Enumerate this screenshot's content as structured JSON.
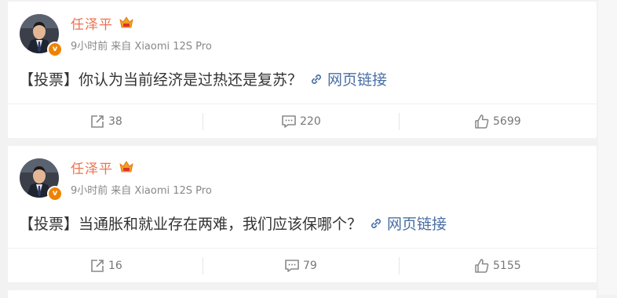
{
  "colors": {
    "author": "#eb7350",
    "link": "#4a6fa5",
    "meta": "#888888",
    "badge": "#f08200"
  },
  "posts": [
    {
      "author": "任泽平",
      "badge_letter": "v",
      "time": "9小时前",
      "source": "来自 Xiaomi 12S Pro",
      "text": "【投票】你认为当前经济是过热还是复苏？",
      "link_label": "网页链接",
      "reposts": "38",
      "comments": "220",
      "likes": "5699"
    },
    {
      "author": "任泽平",
      "badge_letter": "v",
      "time": "9小时前",
      "source": "来自 Xiaomi 12S Pro",
      "text": "【投票】当通胀和就业存在两难，我们应该保哪个？",
      "link_label": "网页链接",
      "reposts": "16",
      "comments": "79",
      "likes": "5155"
    }
  ]
}
